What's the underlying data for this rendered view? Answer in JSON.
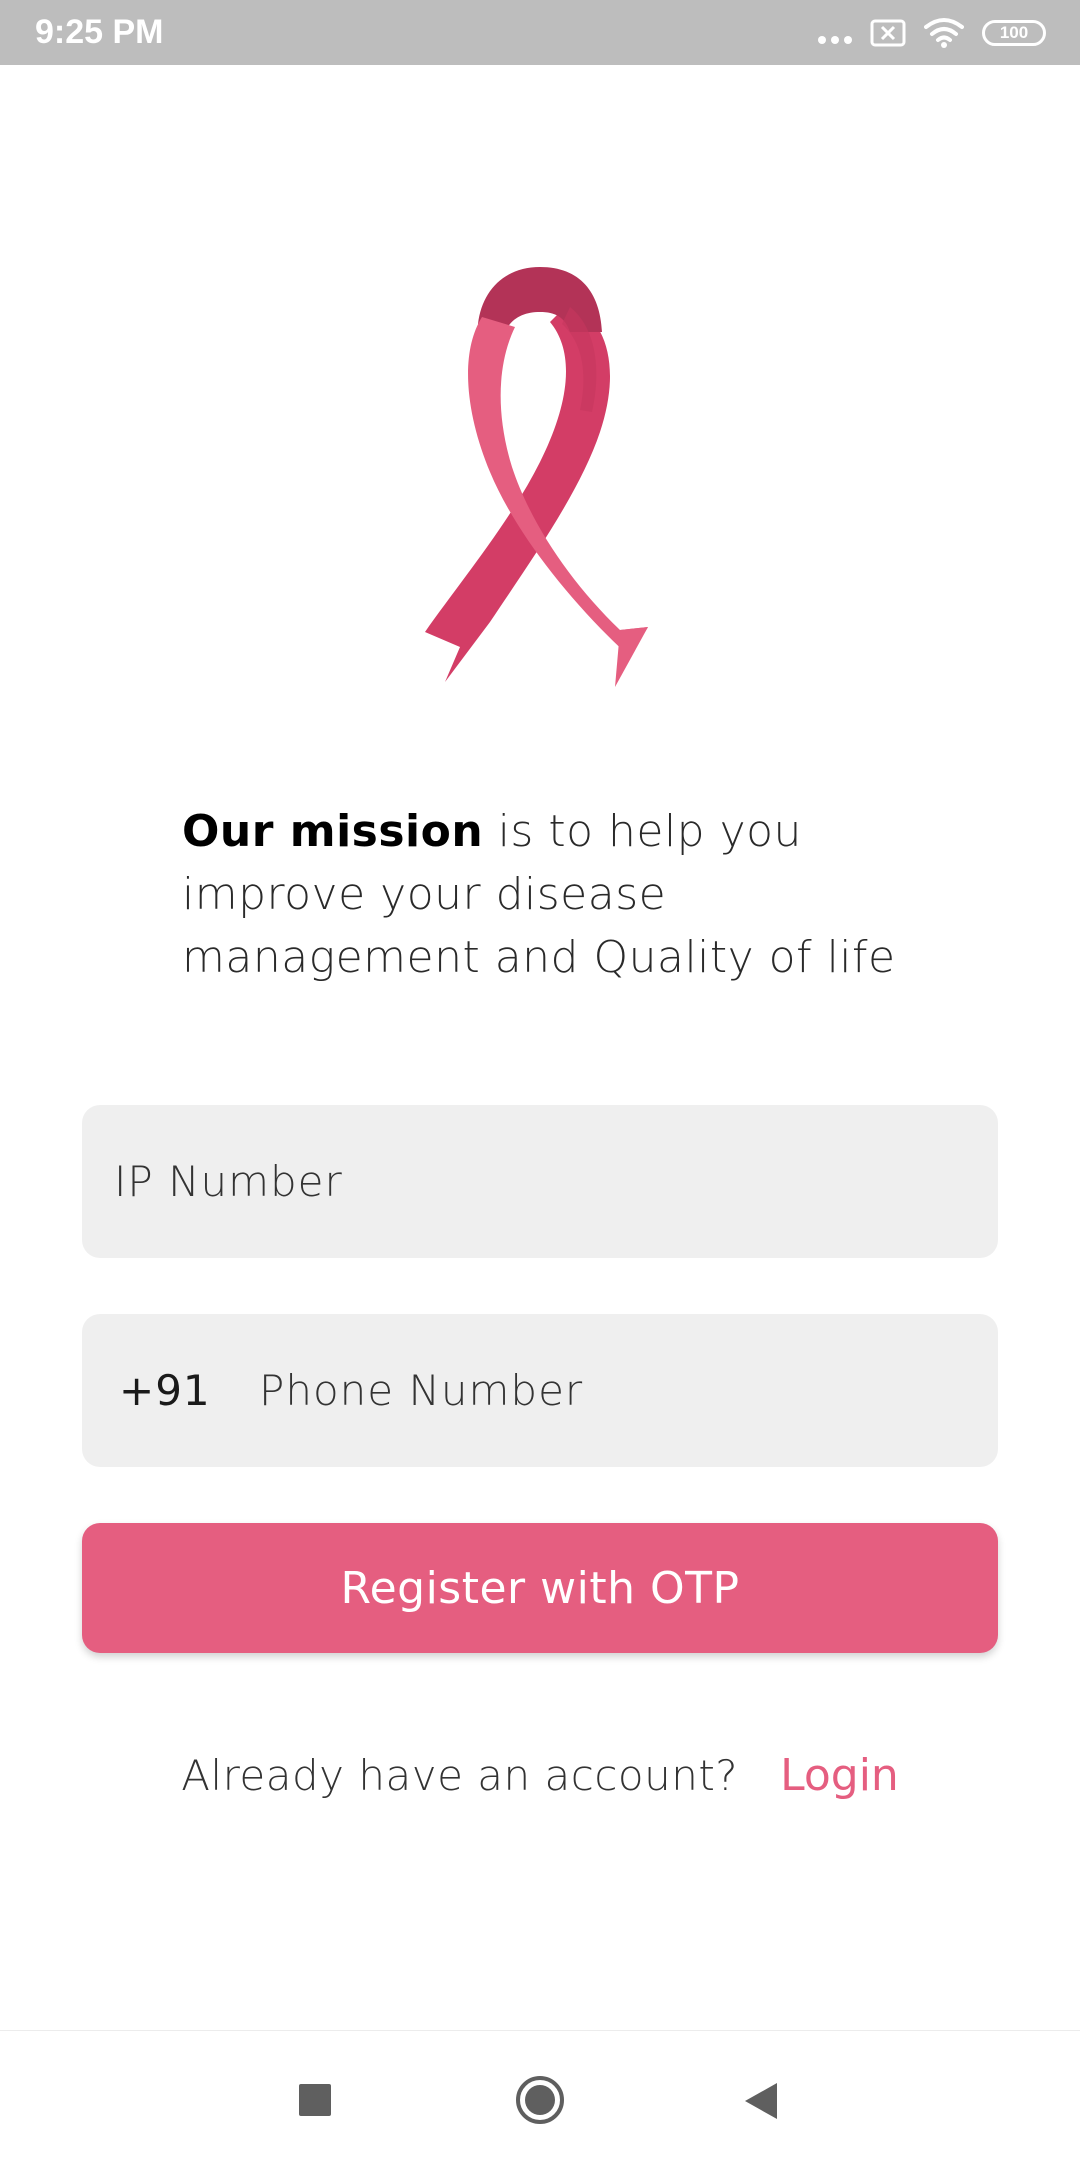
{
  "status_bar": {
    "time": "9:25 PM",
    "battery": "100"
  },
  "mission": {
    "lead": "Our mission",
    "rest": " is to help you improve your disease management and Quality of life"
  },
  "form": {
    "ip_placeholder": "IP Number",
    "phone_prefix": "+91",
    "phone_placeholder": "Phone Number",
    "register_label": "Register with OTP"
  },
  "login": {
    "question": "Already have an account?",
    "link_label": "Login"
  },
  "colors": {
    "accent": "#e55e80",
    "field_bg": "#efefef",
    "status_bar": "#bdbdbd"
  },
  "icons": {
    "logo": "pink-ribbon-icon",
    "nav_recents": "square-icon",
    "nav_home": "circle-home-icon",
    "nav_back": "triangle-back-icon"
  }
}
